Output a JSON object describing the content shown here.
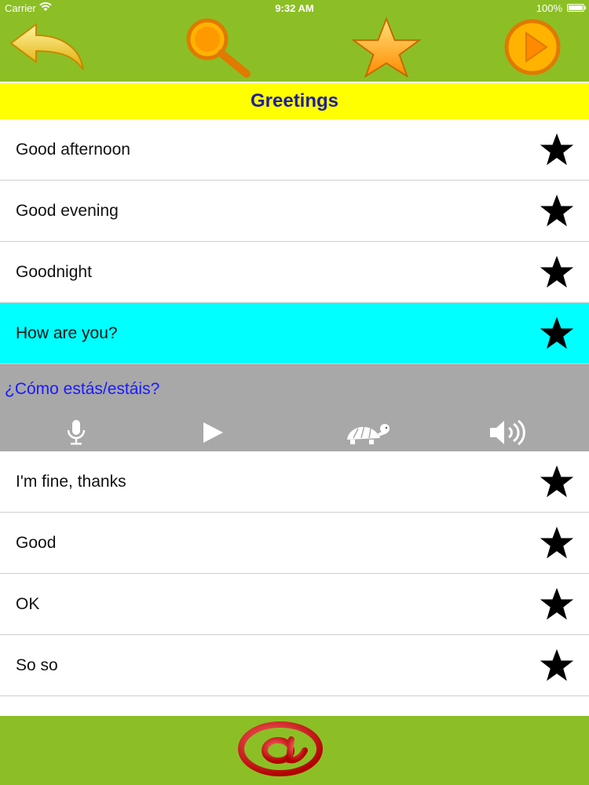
{
  "status_bar": {
    "carrier": "Carrier",
    "time": "9:32 AM",
    "battery": "100%"
  },
  "toolbar": {
    "back_icon": "back-arrow-icon",
    "search_icon": "magnifier-icon",
    "favorites_icon": "star-icon",
    "play_icon": "play-icon"
  },
  "title": "Greetings",
  "phrases_before": [
    {
      "label": "Good afternoon"
    },
    {
      "label": "Good evening"
    },
    {
      "label": "Goodnight"
    }
  ],
  "selected_phrase": {
    "label": "How are you?",
    "translation": "¿Cómo estás/estáis?",
    "controls": [
      "microphone-icon",
      "play-icon",
      "turtle-icon",
      "speaker-icon"
    ]
  },
  "phrases_after": [
    {
      "label": "I'm fine, thanks"
    },
    {
      "label": "Good"
    },
    {
      "label": "OK"
    },
    {
      "label": "So so"
    }
  ],
  "colors": {
    "toolbar_green": "#8cbf26",
    "title_yellow": "#ffff00",
    "title_text": "#1e1e9e",
    "selected_row": "#00ffff",
    "translation_text": "#1a1aff",
    "detail_gray": "#a8a8a8"
  },
  "bottom_bar": {
    "email_icon": "at-sign-icon"
  }
}
